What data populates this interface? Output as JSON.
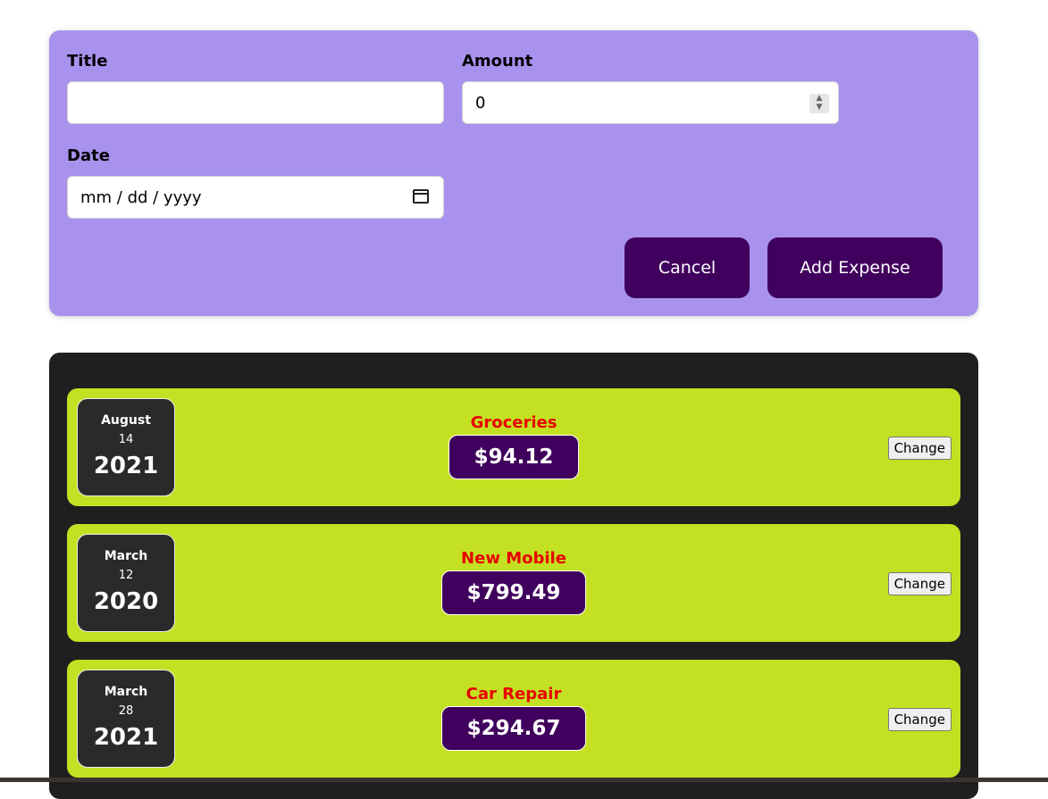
{
  "form": {
    "title_label": "Title",
    "title_value": "",
    "amount_label": "Amount",
    "amount_value": "0",
    "date_label": "Date",
    "date_placeholder": "mm / dd / yyyy",
    "cancel_label": "Cancel",
    "add_label": "Add Expense"
  },
  "expenses": [
    {
      "month": "August",
      "day": "14",
      "year": "2021",
      "title": "Groceries",
      "amount": "$94.12",
      "change_label": "Change"
    },
    {
      "month": "March",
      "day": "12",
      "year": "2020",
      "title": "New Mobile",
      "amount": "$799.49",
      "change_label": "Change"
    },
    {
      "month": "March",
      "day": "28",
      "year": "2021",
      "title": "Car Repair",
      "amount": "$294.67",
      "change_label": "Change"
    }
  ],
  "colors": {
    "form_bg": "#a892ee",
    "button_bg": "#40005d",
    "list_bg": "#1f1f1f",
    "row_bg": "#c4e022",
    "title_color": "#e80000"
  }
}
